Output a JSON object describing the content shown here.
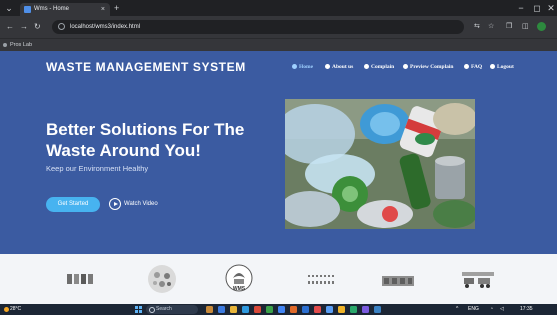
{
  "browser": {
    "tab_title": "Wms - Home",
    "tab_close": "×",
    "new_tab": "+",
    "url": "localhost/wms3/index.html",
    "bookmark": "Pros Lab",
    "icons": {
      "back": "←",
      "forward": "→",
      "reload": "↻",
      "star": "☆",
      "extensions": "❒",
      "tabs": "◫",
      "minimize": "−",
      "maximize": "◻",
      "close": "✕"
    }
  },
  "site": {
    "brand": "WASTE MANAGEMENT SYSTEM",
    "nav": [
      {
        "label": "Home",
        "icon": "home-icon",
        "active": true
      },
      {
        "label": "About us",
        "icon": "info-icon",
        "active": false
      },
      {
        "label": "Complain",
        "icon": "document-icon",
        "active": false
      },
      {
        "label": "Preview Complain",
        "icon": "edit-icon",
        "active": false
      },
      {
        "label": "FAQ",
        "icon": "question-icon",
        "active": false
      },
      {
        "label": "Logout",
        "icon": "logout-icon",
        "active": false
      }
    ],
    "headline": "Better Solutions For The Waste Around You!",
    "tagline": "Keep our Environment Healthy",
    "cta_primary": "Get Started",
    "cta_secondary": "Watch Video",
    "accent_color": "#47b3f0",
    "hero_bg": "#3b5ba1"
  },
  "partners": [
    {
      "name": "bins-logo"
    },
    {
      "name": "recycle-collage-logo"
    },
    {
      "name": "wms-logo",
      "text": "WMS"
    },
    {
      "name": "dotted-logo"
    },
    {
      "name": "building-logo"
    },
    {
      "name": "trucks-logo"
    }
  ],
  "taskbar": {
    "weather": "28°C",
    "search": "Search",
    "time": "17:35",
    "lang": "ENG"
  }
}
